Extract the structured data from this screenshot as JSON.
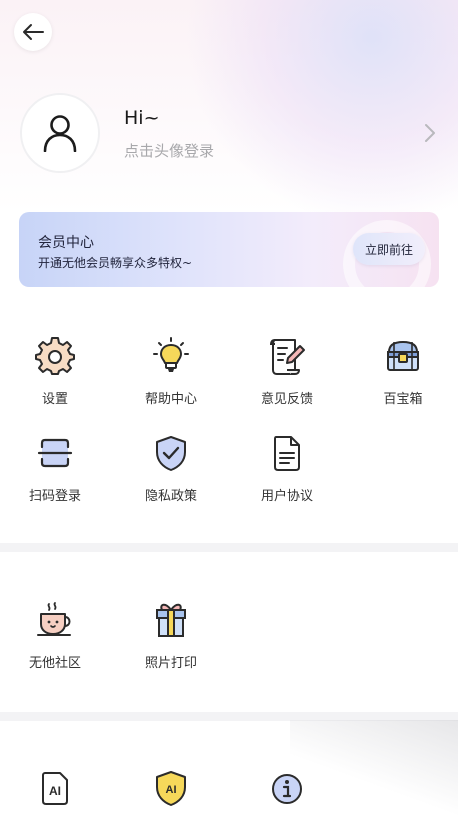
{
  "profile": {
    "greeting": "Hi~",
    "login_hint": "点击头像登录"
  },
  "vip": {
    "title": "会员中心",
    "subtitle": "开通无他会员畅享众多特权~",
    "button": "立即前往"
  },
  "tools": [
    {
      "label": "设置",
      "icon": "settings-gear-icon"
    },
    {
      "label": "帮助中心",
      "icon": "lightbulb-icon"
    },
    {
      "label": "意见反馈",
      "icon": "feedback-scroll-icon"
    },
    {
      "label": "百宝箱",
      "icon": "treasure-chest-icon"
    },
    {
      "label": "扫码登录",
      "icon": "scan-icon"
    },
    {
      "label": "隐私政策",
      "icon": "shield-check-icon"
    },
    {
      "label": "用户协议",
      "icon": "document-icon"
    }
  ],
  "community": [
    {
      "label": "无他社区",
      "icon": "coffee-cup-icon"
    },
    {
      "label": "照片打印",
      "icon": "gift-box-icon"
    }
  ],
  "ai_section": [
    {
      "icon": "ai-document-icon",
      "text": "AI"
    },
    {
      "icon": "ai-shield-icon",
      "text": "AI"
    },
    {
      "icon": "info-icon"
    }
  ],
  "colors": {
    "accent_blue": "#3d4aa8",
    "vip_gradient_start": "#c7d4f7",
    "vip_gradient_end": "#f6e2f1",
    "icon_yellow": "#f6d85a"
  }
}
